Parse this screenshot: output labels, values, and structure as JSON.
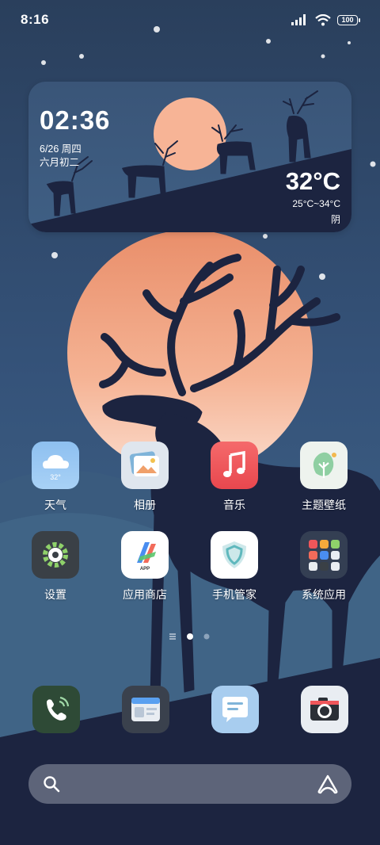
{
  "status_bar": {
    "time": "8:16",
    "battery": "100"
  },
  "widget": {
    "clock": "02:36",
    "date": "6/26 周四",
    "lunar": "六月初二",
    "temperature": "32°C",
    "range": "25°C~34°C",
    "condition": "阴"
  },
  "apps": [
    {
      "label": "天气",
      "icon": "weather-icon",
      "icon_text": "32°"
    },
    {
      "label": "相册",
      "icon": "gallery-icon"
    },
    {
      "label": "音乐",
      "icon": "music-icon"
    },
    {
      "label": "主题壁纸",
      "icon": "themes-icon"
    },
    {
      "label": "设置",
      "icon": "settings-icon"
    },
    {
      "label": "应用商店",
      "icon": "app-store-icon",
      "icon_text": "APP"
    },
    {
      "label": "手机管家",
      "icon": "security-icon"
    },
    {
      "label": "系统应用",
      "icon": "system-apps-folder-icon"
    }
  ],
  "dock": [
    {
      "name": "phone",
      "icon": "phone-icon"
    },
    {
      "name": "browser",
      "icon": "browser-icon"
    },
    {
      "name": "messages",
      "icon": "messages-icon"
    },
    {
      "name": "camera",
      "icon": "camera-icon"
    }
  ],
  "page_indicator": {
    "pages": 2,
    "current": 1
  },
  "colors": {
    "sun": "#f3a37f",
    "deer": "#1c2440",
    "sky": "#35537a",
    "music": "#f0565a",
    "phone": "#2e4a36"
  }
}
